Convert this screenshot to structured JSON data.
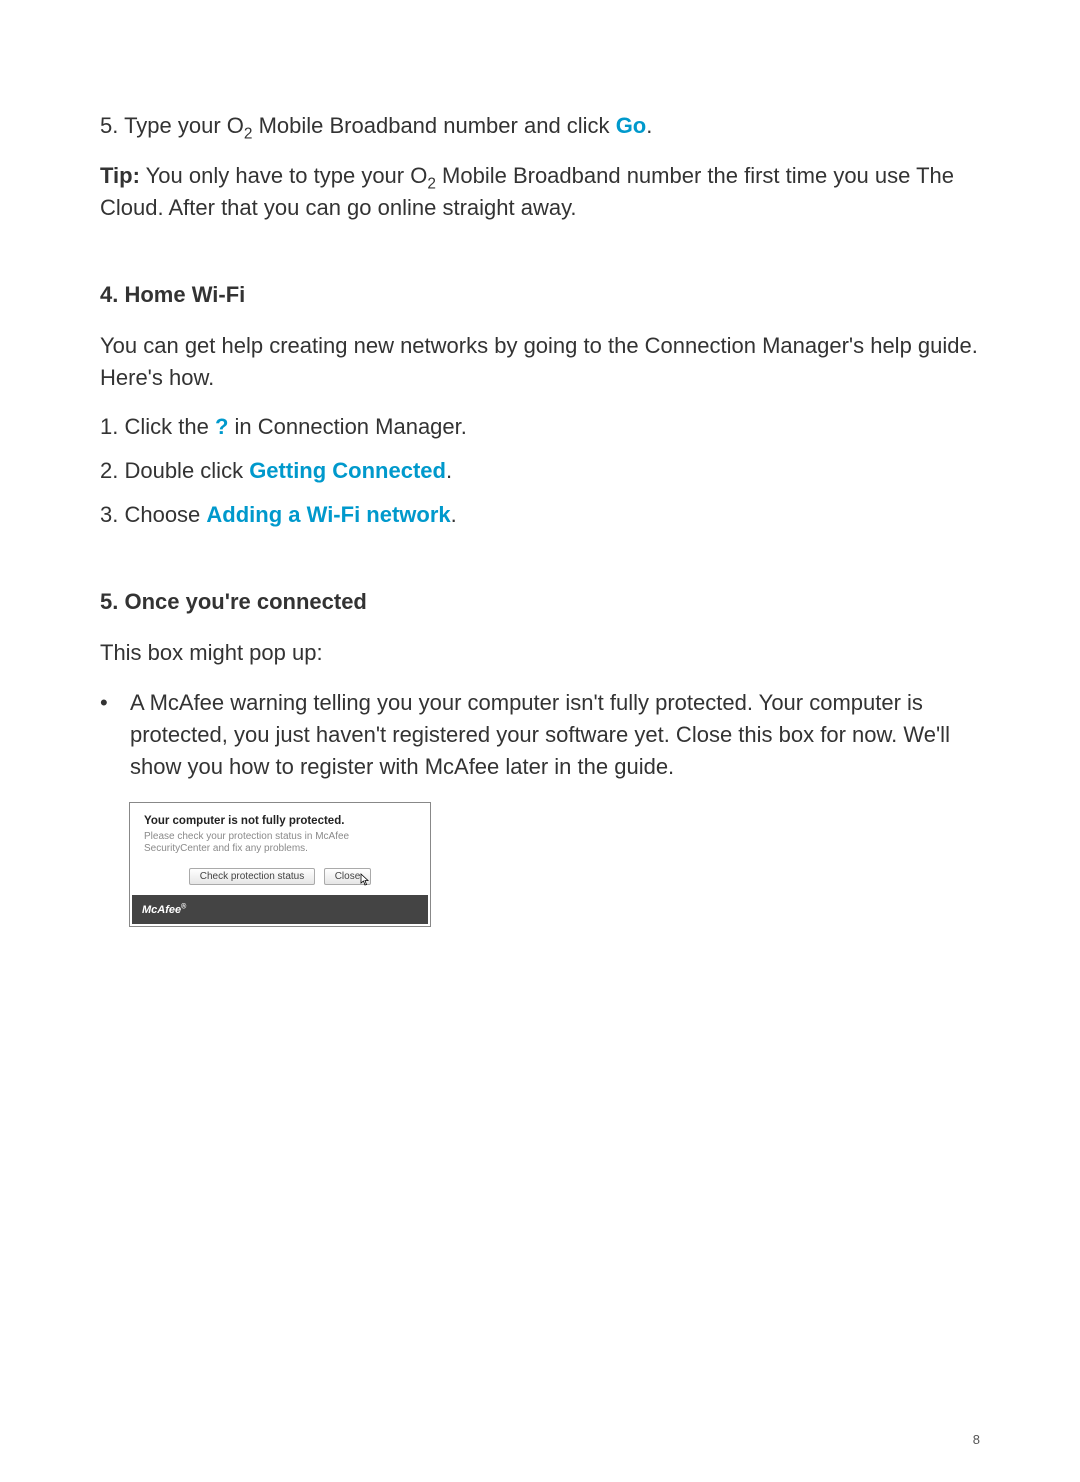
{
  "step5": {
    "prefix": "5. Type your O",
    "sub": "2",
    "mid": " Mobile Broadband number and click ",
    "highlight": "Go",
    "suffix": "."
  },
  "tip": {
    "label": "Tip:",
    "text1": " You only have to type your O",
    "sub": "2",
    "text2": " Mobile Broadband number the first time you use The Cloud. After that you can go online straight away."
  },
  "section4": {
    "heading": "4. Home Wi-Fi",
    "intro": "You can get help creating new networks by going to the Connection Manager's help guide. Here's how.",
    "item1_pre": "1. Click the ",
    "item1_hl": "?",
    "item1_post": " in Connection Manager.",
    "item2_pre": "2. Double click ",
    "item2_hl": "Getting Connected",
    "item2_post": ".",
    "item3_pre": "3. Choose ",
    "item3_hl": "Adding a Wi-Fi network",
    "item3_post": "."
  },
  "section5": {
    "heading": "5. Once you're connected",
    "intro": "This box might pop up:",
    "bullet_marker": "•",
    "bullet_text": "A McAfee warning telling you your computer isn't fully protected. Your computer is protected, you just haven't registered your software yet. Close this box for now. We'll show you how to register with McAfee later in the guide."
  },
  "dialog": {
    "title": "Your computer is not fully protected.",
    "body": "Please check your protection status in McAfee SecurityCenter and fix any problems.",
    "btn_check": "Check protection status",
    "btn_close": "Close",
    "brand": "McAfee",
    "reg": "®"
  },
  "page_number": "8"
}
